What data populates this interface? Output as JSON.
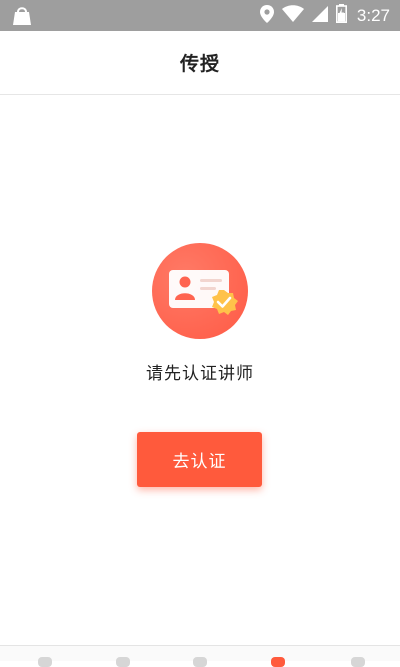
{
  "status_bar": {
    "time": "3:27",
    "icons": [
      "shopping-bag-icon",
      "location-icon",
      "wifi-icon",
      "signal-icon",
      "battery-icon"
    ]
  },
  "header": {
    "title": "传授"
  },
  "main": {
    "icon": "id-card-verified-icon",
    "prompt": "请先认证讲师",
    "button_label": "去认证"
  },
  "colors": {
    "accent": "#ff5a3c",
    "icon_circle": "#ff6b55",
    "check_badge": "#ffc24a",
    "status_bar": "#9e9e9e"
  }
}
